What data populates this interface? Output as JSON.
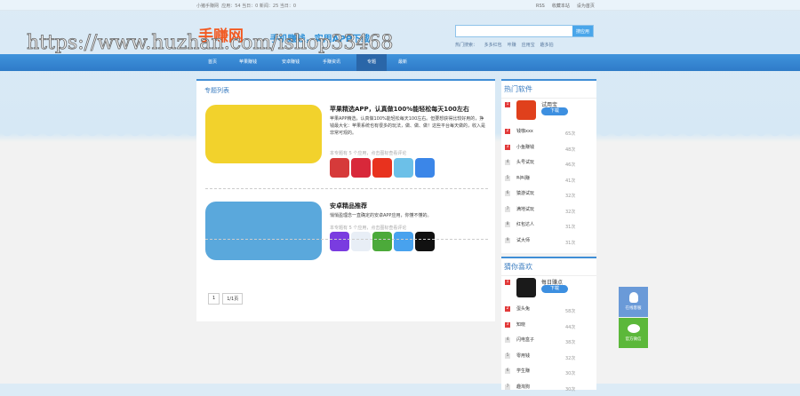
{
  "topbar": {
    "site": "小猪手赚网",
    "stats": "应用：54 当日：0 新闻：25 当日：0",
    "links": [
      "RSS",
      "收藏本站",
      "设为首页"
    ]
  },
  "header": {
    "logo": "手赚网",
    "slogan": "- 手机赚钱，实用APP下载",
    "search_button": "搜应用",
    "search_value": "",
    "hot_label": "热门搜索：",
    "hot_terms": [
      "多多红包",
      "咔赚",
      "应用宝",
      "趣多拍"
    ]
  },
  "watermark": "https://www.huzhan.com/ishop33468",
  "nav": [
    "首页",
    "苹果赚钱",
    "安卓赚钱",
    "手赚资讯",
    "专题",
    "最新"
  ],
  "main": {
    "title": "专题列表",
    "items": [
      {
        "title": "苹果精选APP，认真做100%能轻松每天100左右",
        "desc": "苹果APP精选，认真做100%能轻松每天100左右。但要想获得比较好用的，挣钱最大化：苹果系统也有很多的玩法，做、做、做！这些平台每天做的，收入是非常可观的。",
        "note": "本专题有 5 个应用，点击图标查看评论"
      },
      {
        "title": "安卓精品推荐",
        "desc": "悄悄盈理念一直确定的安卓APP应用，你懂不懂的。",
        "note": "本专题有 5 个应用，点击图标查看评论"
      }
    ],
    "pager": [
      "1",
      "1/1页"
    ]
  },
  "hot_software": {
    "title": "热门软件",
    "top": {
      "name": "试用宝",
      "download": "下载"
    },
    "items": [
      {
        "rank": "2",
        "name": "钱咖xxx",
        "count": "65次"
      },
      {
        "rank": "3",
        "name": "小鱼赚钱",
        "count": "48次"
      },
      {
        "rank": "4",
        "name": "头号试玩",
        "count": "46次"
      },
      {
        "rank": "5",
        "name": "叫叫赚",
        "count": "41次"
      },
      {
        "rank": "6",
        "name": "猿游试玩",
        "count": "32次"
      },
      {
        "rank": "7",
        "name": "满地试玩",
        "count": "32次"
      },
      {
        "rank": "8",
        "name": "红包达人",
        "count": "31次"
      },
      {
        "rank": "9",
        "name": "试大师",
        "count": "31次"
      }
    ]
  },
  "guess": {
    "title": "猜你喜欢",
    "top": {
      "name": "每日赚点",
      "download": "下载"
    },
    "items": [
      {
        "rank": "2",
        "name": "蛋头兔",
        "count": "58次"
      },
      {
        "rank": "3",
        "name": "知晓",
        "count": "44次"
      },
      {
        "rank": "4",
        "name": "闪电盒子",
        "count": "38次"
      },
      {
        "rank": "5",
        "name": "零用钱",
        "count": "32次"
      },
      {
        "rank": "6",
        "name": "学生赚",
        "count": "30次"
      },
      {
        "rank": "7",
        "name": "趣淘狗",
        "count": "30次"
      }
    ]
  },
  "float": {
    "qq": "在线客服",
    "wechat": "官方微信"
  }
}
